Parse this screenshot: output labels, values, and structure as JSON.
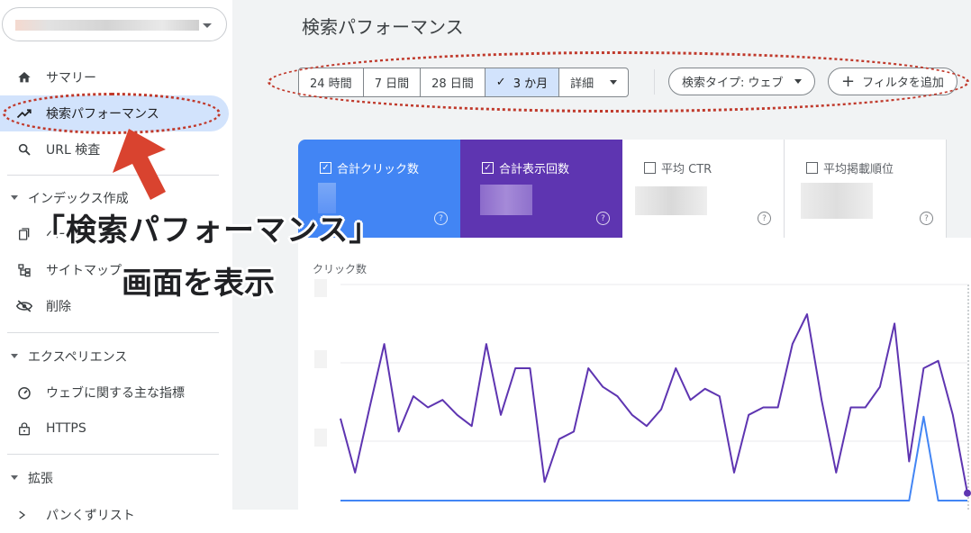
{
  "page_title": "検索パフォーマンス",
  "sidebar": {
    "items": [
      {
        "label": "サマリー",
        "icon": "home-icon"
      },
      {
        "label": "検索パフォーマンス",
        "icon": "trending-up-icon"
      },
      {
        "label": "URL 検査",
        "icon": "search-icon"
      }
    ],
    "sections": [
      {
        "label": "インデックス作成",
        "items": [
          {
            "label": "ページ",
            "icon": "pages-icon"
          },
          {
            "label": "サイトマップ",
            "icon": "sitemap-icon"
          },
          {
            "label": "削除",
            "icon": "eye-off-icon"
          }
        ]
      },
      {
        "label": "エクスペリエンス",
        "items": [
          {
            "label": "ウェブに関する主な指標",
            "icon": "speed-icon"
          },
          {
            "label": "HTTPS",
            "icon": "lock-icon"
          }
        ]
      },
      {
        "label": "拡張",
        "items": [
          {
            "label": "パンくずリスト",
            "icon": "breadcrumb-icon"
          }
        ]
      }
    ]
  },
  "date_filters": [
    "24 時間",
    "7 日間",
    "28 日間",
    "3 か月",
    "詳細"
  ],
  "selected_filter": "3 か月",
  "search_type_button": "検索タイプ: ウェブ",
  "add_filter_button": "フィルタを追加",
  "metrics": [
    {
      "label": "合計クリック数",
      "checked": true,
      "color": "#4285f4"
    },
    {
      "label": "合計表示回数",
      "checked": true,
      "color": "#5e35b1"
    },
    {
      "label": "平均 CTR",
      "checked": false
    },
    {
      "label": "平均掲載順位",
      "checked": false
    }
  ],
  "chart": {
    "y_label": "クリック数"
  },
  "chart_data": {
    "type": "line",
    "series": [
      {
        "name": "合計表示回数",
        "color": "#5e35b1",
        "values": [
          44,
          15,
          50,
          84,
          37,
          56,
          50,
          54,
          46,
          40,
          84,
          46,
          71,
          71,
          10,
          33,
          37,
          71,
          61,
          56,
          46,
          40,
          49,
          71,
          54,
          60,
          56,
          15,
          46,
          50,
          50,
          84,
          100,
          54,
          15,
          50,
          50,
          61,
          95,
          21,
          71,
          75,
          46,
          4
        ]
      },
      {
        "name": "合計クリック数",
        "color": "#4285f4",
        "values": [
          0,
          0,
          0,
          0,
          0,
          0,
          0,
          0,
          0,
          0,
          0,
          0,
          0,
          0,
          0,
          0,
          0,
          0,
          0,
          0,
          0,
          0,
          0,
          0,
          0,
          0,
          0,
          0,
          0,
          0,
          0,
          0,
          0,
          0,
          0,
          0,
          0,
          0,
          0,
          0,
          45,
          0,
          0,
          0
        ]
      }
    ]
  },
  "annotation": {
    "line1": "「検索パフォーマンス」",
    "line2": "画面を表示"
  },
  "colors": {
    "accent": "#1a73e8",
    "active_bg": "#d2e3fc",
    "annotation_red": "#c0392b"
  }
}
